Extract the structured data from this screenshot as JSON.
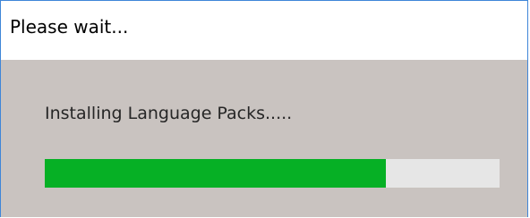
{
  "dialog": {
    "title": "Please wait...",
    "message": "Installing Language Packs.....",
    "progress": 0.75
  },
  "colors": {
    "progress_fill": "#06b025",
    "progress_track": "#e6e6e6",
    "dialog_background": "#c9c3c0",
    "window_border": "#3f86d8"
  }
}
